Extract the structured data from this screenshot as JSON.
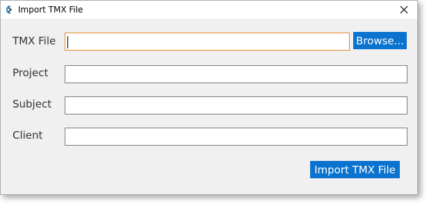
{
  "window": {
    "title": "Import TMX File",
    "close_symbol": "✕",
    "icon": "app-logo-icon"
  },
  "form": {
    "fields": [
      {
        "label": "TMX File",
        "value": "",
        "placeholder": ""
      },
      {
        "label": "Project",
        "value": "",
        "placeholder": ""
      },
      {
        "label": "Subject",
        "value": "",
        "placeholder": ""
      },
      {
        "label": "Client",
        "value": "",
        "placeholder": ""
      }
    ],
    "browse_label": "Browse...",
    "import_label": "Import TMX File"
  },
  "colors": {
    "accent": "#0a72cf",
    "focus_border": "#e3871b",
    "dialog_bg": "#f0f0f0"
  }
}
